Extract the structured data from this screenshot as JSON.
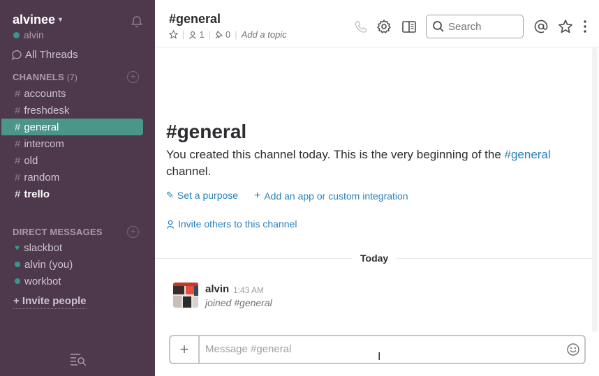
{
  "sidebar": {
    "team_name": "alvinee",
    "username": "alvin",
    "all_threads": "All Threads",
    "channels_heading": "CHANNELS",
    "channels_count": "(7)",
    "channels": [
      {
        "name": "accounts"
      },
      {
        "name": "freshdesk"
      },
      {
        "name": "general"
      },
      {
        "name": "intercom"
      },
      {
        "name": "old"
      },
      {
        "name": "random"
      },
      {
        "name": "trello"
      }
    ],
    "active_channel": "general",
    "unread_channel": "trello",
    "dm_heading": "DIRECT MESSAGES",
    "dms": [
      {
        "name": "slackbot",
        "status": "heart"
      },
      {
        "name": "alvin (you)",
        "status": "online"
      },
      {
        "name": "workbot",
        "status": "online"
      }
    ],
    "invite": "+ Invite people"
  },
  "header": {
    "channel": "#general",
    "members": "1",
    "pinned": "0",
    "topic": "Add a topic",
    "search_placeholder": "Search"
  },
  "intro": {
    "title": "#general",
    "text_before": "You created this channel today. This is the very beginning of the ",
    "channel_link": "#general",
    "text_after": " channel.",
    "set_purpose": "Set a purpose",
    "add_app": "Add an app or custom integration",
    "invite_others": "Invite others to this channel"
  },
  "messages": {
    "day_label": "Today",
    "items": [
      {
        "author": "alvin",
        "time": "1:43 AM",
        "body": "joined #general"
      }
    ]
  },
  "composer": {
    "placeholder": "Message #general"
  },
  "colors": {
    "sidebar_bg": "#4d394b",
    "active_channel": "#4c9689",
    "link": "#2a80b9",
    "presence": "#38978d"
  }
}
